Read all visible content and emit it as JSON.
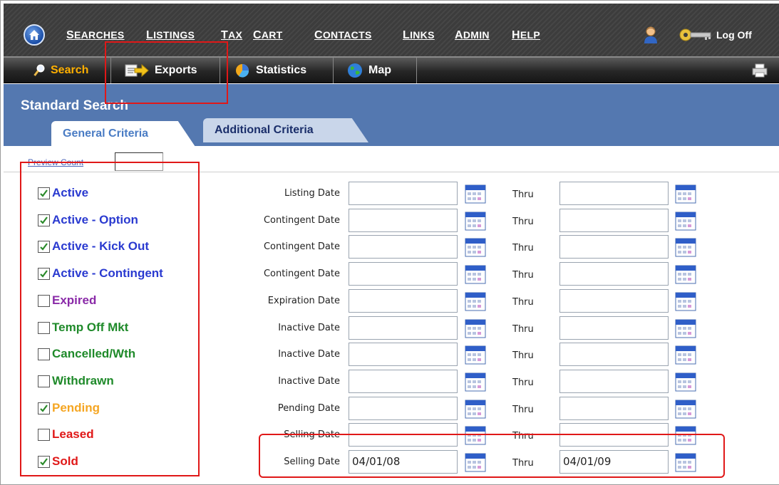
{
  "colors": {
    "nav_bg": "#3c3c3c",
    "title_bar": "#5478b0",
    "accent_orange": "#ffb000",
    "annotation": "#e01818"
  },
  "topnav": {
    "home_icon": "home-icon",
    "items": [
      {
        "id": "searches",
        "label": "Searches"
      },
      {
        "id": "listings",
        "label": "Listings"
      },
      {
        "id": "tax",
        "label": "Tax"
      },
      {
        "id": "cart",
        "label": "Cart"
      },
      {
        "id": "contacts",
        "label": "Contacts"
      },
      {
        "id": "links",
        "label": "Links"
      },
      {
        "id": "admin",
        "label": "Admin"
      },
      {
        "id": "help",
        "label": "Help"
      }
    ],
    "user_icon": "user-icon",
    "key_icon": "key-icon",
    "logoff_label": "Log Off"
  },
  "subtoolbar": {
    "items": [
      {
        "id": "search",
        "label": "Search",
        "icon": "magnifier-icon"
      },
      {
        "id": "exports",
        "label": "Exports",
        "icon": "export-arrow-icon"
      },
      {
        "id": "statistics",
        "label": "Statistics",
        "icon": "pie-chart-icon"
      },
      {
        "id": "map",
        "label": "Map",
        "icon": "globe-icon"
      }
    ],
    "print_icon": "printer-icon"
  },
  "page": {
    "title": "Standard Search",
    "tabs": [
      {
        "id": "general",
        "label": "General Criteria",
        "active": true
      },
      {
        "id": "additional",
        "label": "Additional Criteria",
        "active": false
      }
    ],
    "preview_count_label": "Preview Count",
    "preview_count_value": ""
  },
  "statuses": [
    {
      "label": "Active",
      "checked": true,
      "color": "#2a3ad0"
    },
    {
      "label": "Active - Option",
      "checked": true,
      "color": "#2a3ad0"
    },
    {
      "label": "Active - Kick Out",
      "checked": true,
      "color": "#2a3ad0"
    },
    {
      "label": "Active - Contingent",
      "checked": true,
      "color": "#2a3ad0"
    },
    {
      "label": "Expired",
      "checked": false,
      "color": "#8a2aa8"
    },
    {
      "label": "Temp Off Mkt",
      "checked": false,
      "color": "#1f8a2a"
    },
    {
      "label": "Cancelled/Wth",
      "checked": false,
      "color": "#1f8a2a"
    },
    {
      "label": "Withdrawn",
      "checked": false,
      "color": "#1f8a2a"
    },
    {
      "label": "Pending",
      "checked": true,
      "color": "#f5a623"
    },
    {
      "label": "Leased",
      "checked": false,
      "color": "#e01818"
    },
    {
      "label": "Sold",
      "checked": true,
      "color": "#e01818"
    }
  ],
  "date_rows": [
    {
      "label": "Listing Date",
      "from": "",
      "thru_label": "Thru",
      "to": ""
    },
    {
      "label": "Contingent Date",
      "from": "",
      "thru_label": "Thru",
      "to": ""
    },
    {
      "label": "Contingent Date",
      "from": "",
      "thru_label": "Thru",
      "to": ""
    },
    {
      "label": "Contingent Date",
      "from": "",
      "thru_label": "Thru",
      "to": ""
    },
    {
      "label": "Expiration Date",
      "from": "",
      "thru_label": "Thru",
      "to": ""
    },
    {
      "label": "Inactive Date",
      "from": "",
      "thru_label": "Thru",
      "to": ""
    },
    {
      "label": "Inactive Date",
      "from": "",
      "thru_label": "Thru",
      "to": ""
    },
    {
      "label": "Inactive Date",
      "from": "",
      "thru_label": "Thru",
      "to": ""
    },
    {
      "label": "Pending Date",
      "from": "",
      "thru_label": "Thru",
      "to": ""
    },
    {
      "label": "Selling Date",
      "from": "",
      "thru_label": "Thru",
      "to": ""
    },
    {
      "label": "Selling Date",
      "from": "04/01/08",
      "thru_label": "Thru",
      "to": "04/01/09"
    }
  ]
}
